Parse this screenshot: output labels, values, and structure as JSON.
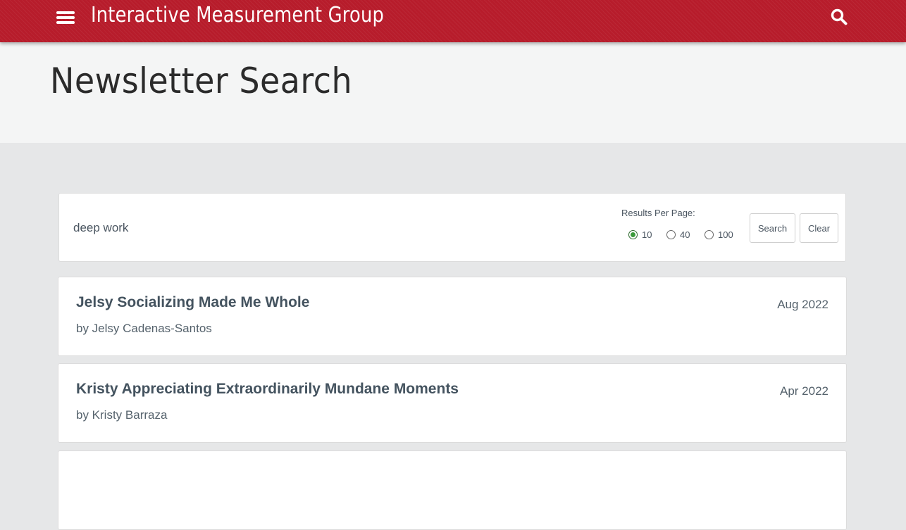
{
  "header": {
    "brand": "Interactive Measurement Group",
    "menu_icon": "hamburger-menu-icon",
    "search_icon": "search-icon",
    "color": "#b71c2b"
  },
  "page": {
    "title": "Newsletter Search"
  },
  "search": {
    "query": "deep work",
    "results_per_page_label": "Results Per Page:",
    "options": [
      "10",
      "40",
      "100"
    ],
    "selected": "10",
    "search_label": "Search",
    "clear_label": "Clear"
  },
  "results": [
    {
      "title": "Jelsy Socializing Made Me Whole",
      "author": "by Jelsy Cadenas-Santos",
      "date": "Aug 2022"
    },
    {
      "title": "Kristy Appreciating Extraordinarily Mundane Moments",
      "author": "by Kristy Barraza",
      "date": "Apr 2022"
    }
  ]
}
